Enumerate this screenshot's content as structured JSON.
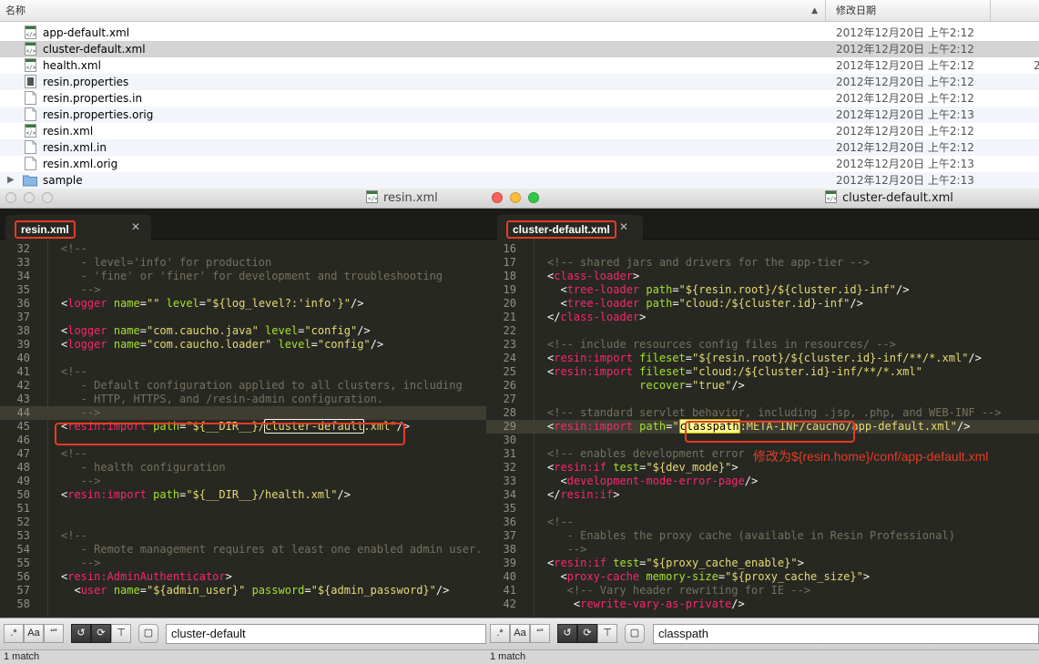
{
  "finder": {
    "col_name": "名称",
    "col_date": "修改日期",
    "rows": [
      {
        "name": "app-default.xml",
        "date": "2012年12月20日 上午2:12",
        "icon": "xml-file-icon"
      },
      {
        "name": "cluster-default.xml",
        "date": "2012年12月20日 上午2:12",
        "icon": "xml-file-icon"
      },
      {
        "name": "health.xml",
        "date": "2012年12月20日 上午2:12",
        "icon": "xml-file-icon",
        "extra": "2"
      },
      {
        "name": "resin.properties",
        "date": "2012年12月20日 上午2:12",
        "icon": "properties-file-icon"
      },
      {
        "name": "resin.properties.in",
        "date": "2012年12月20日 上午2:12",
        "icon": "document-icon"
      },
      {
        "name": "resin.properties.orig",
        "date": "2012年12月20日 上午2:13",
        "icon": "document-icon"
      },
      {
        "name": "resin.xml",
        "date": "2012年12月20日 上午2:12",
        "icon": "xml-file-icon"
      },
      {
        "name": "resin.xml.in",
        "date": "2012年12月20日 上午2:12",
        "icon": "document-icon"
      },
      {
        "name": "resin.xml.orig",
        "date": "2012年12月20日 上午2:13",
        "icon": "document-icon"
      },
      {
        "name": "sample",
        "date": "2012年12月20日 上午2:13",
        "icon": "folder-icon"
      }
    ]
  },
  "left_window": {
    "title": "resin.xml",
    "tab": "resin.xml",
    "find_text": "cluster-default",
    "status": "1 match",
    "lines": [
      {
        "n": "32",
        "segs": [
          [
            "com",
            "<!--"
          ]
        ]
      },
      {
        "n": "33",
        "segs": [
          [
            "com",
            "   - level='info' for production"
          ]
        ]
      },
      {
        "n": "34",
        "segs": [
          [
            "com",
            "   - 'fine' or 'finer' for development and troubleshooting"
          ]
        ]
      },
      {
        "n": "35",
        "segs": [
          [
            "com",
            "   -->"
          ]
        ]
      },
      {
        "n": "36",
        "segs": [
          [
            "p",
            "<"
          ],
          [
            "tag",
            "logger"
          ],
          [
            "p",
            " "
          ],
          [
            "att",
            "name"
          ],
          [
            "p",
            "="
          ],
          [
            "str",
            "\"\""
          ],
          [
            "p",
            " "
          ],
          [
            "att",
            "level"
          ],
          [
            "p",
            "="
          ],
          [
            "str",
            "\"${log_level?:'info'}\""
          ],
          [
            "p",
            "/>"
          ]
        ]
      },
      {
        "n": "37",
        "segs": []
      },
      {
        "n": "38",
        "segs": [
          [
            "p",
            "<"
          ],
          [
            "tag",
            "logger"
          ],
          [
            "p",
            " "
          ],
          [
            "att",
            "name"
          ],
          [
            "p",
            "="
          ],
          [
            "str",
            "\"com.caucho.java\""
          ],
          [
            "p",
            " "
          ],
          [
            "att",
            "level"
          ],
          [
            "p",
            "="
          ],
          [
            "str",
            "\"config\""
          ],
          [
            "p",
            "/>"
          ]
        ]
      },
      {
        "n": "39",
        "segs": [
          [
            "p",
            "<"
          ],
          [
            "tag",
            "logger"
          ],
          [
            "p",
            " "
          ],
          [
            "att",
            "name"
          ],
          [
            "p",
            "="
          ],
          [
            "str",
            "\"com.caucho.loader\""
          ],
          [
            "p",
            " "
          ],
          [
            "att",
            "level"
          ],
          [
            "p",
            "="
          ],
          [
            "str",
            "\"config\""
          ],
          [
            "p",
            "/>"
          ]
        ]
      },
      {
        "n": "40",
        "segs": []
      },
      {
        "n": "41",
        "segs": [
          [
            "com",
            "<!--"
          ]
        ]
      },
      {
        "n": "42",
        "segs": [
          [
            "com",
            "   - Default configuration applied to all clusters, including"
          ]
        ]
      },
      {
        "n": "43",
        "segs": [
          [
            "com",
            "   - HTTP, HTTPS, and /resin-admin configuration."
          ]
        ]
      },
      {
        "n": "44",
        "segs": [
          [
            "com",
            "   -->"
          ]
        ],
        "hl": true
      },
      {
        "n": "45",
        "segs": [
          [
            "p",
            "<"
          ],
          [
            "tag",
            "resin:import"
          ],
          [
            "p",
            " "
          ],
          [
            "att",
            "path"
          ],
          [
            "p",
            "="
          ],
          [
            "str",
            "\"${__DIR__}/"
          ],
          [
            "strbox",
            "cluster-default"
          ],
          [
            "str",
            ".xml\""
          ],
          [
            "p",
            "/>"
          ]
        ]
      },
      {
        "n": "46",
        "segs": []
      },
      {
        "n": "47",
        "segs": [
          [
            "com",
            "<!--"
          ]
        ]
      },
      {
        "n": "48",
        "segs": [
          [
            "com",
            "   - health configuration"
          ]
        ]
      },
      {
        "n": "49",
        "segs": [
          [
            "com",
            "   -->"
          ]
        ]
      },
      {
        "n": "50",
        "segs": [
          [
            "p",
            "<"
          ],
          [
            "tag",
            "resin:import"
          ],
          [
            "p",
            " "
          ],
          [
            "att",
            "path"
          ],
          [
            "p",
            "="
          ],
          [
            "str",
            "\"${__DIR__}/health.xml\""
          ],
          [
            "p",
            "/>"
          ]
        ]
      },
      {
        "n": "51",
        "segs": []
      },
      {
        "n": "52",
        "segs": []
      },
      {
        "n": "53",
        "segs": [
          [
            "com",
            "<!--"
          ]
        ]
      },
      {
        "n": "54",
        "segs": [
          [
            "com",
            "   - Remote management requires at least one enabled admin user."
          ]
        ]
      },
      {
        "n": "55",
        "segs": [
          [
            "com",
            "   -->"
          ]
        ]
      },
      {
        "n": "56",
        "segs": [
          [
            "p",
            "<"
          ],
          [
            "tag",
            "resin:AdminAuthenticator"
          ],
          [
            "p",
            ">"
          ]
        ]
      },
      {
        "n": "57",
        "segs": [
          [
            "p",
            "  <"
          ],
          [
            "tag",
            "user"
          ],
          [
            "p",
            " "
          ],
          [
            "att",
            "name"
          ],
          [
            "p",
            "="
          ],
          [
            "str",
            "\"${admin_user}\""
          ],
          [
            "p",
            " "
          ],
          [
            "att",
            "password"
          ],
          [
            "p",
            "="
          ],
          [
            "str",
            "\"${admin_password}\""
          ],
          [
            "p",
            "/>"
          ]
        ]
      },
      {
        "n": "58",
        "segs": []
      }
    ]
  },
  "right_window": {
    "title": "cluster-default.xml",
    "tab": "cluster-default.xml",
    "find_text": "classpath",
    "status": "1 match",
    "annotation": "修改为${resin.home}/conf/app-default.xml",
    "lines": [
      {
        "n": "16",
        "segs": []
      },
      {
        "n": "17",
        "segs": [
          [
            "com",
            "<!-- shared jars and drivers for the app-tier -->"
          ]
        ]
      },
      {
        "n": "18",
        "segs": [
          [
            "p",
            "<"
          ],
          [
            "tag",
            "class-loader"
          ],
          [
            "p",
            ">"
          ]
        ]
      },
      {
        "n": "19",
        "segs": [
          [
            "p",
            "  <"
          ],
          [
            "tag",
            "tree-loader"
          ],
          [
            "p",
            " "
          ],
          [
            "att",
            "path"
          ],
          [
            "p",
            "="
          ],
          [
            "str",
            "\"${resin.root}/${cluster.id}-inf\""
          ],
          [
            "p",
            "/>"
          ]
        ]
      },
      {
        "n": "20",
        "segs": [
          [
            "p",
            "  <"
          ],
          [
            "tag",
            "tree-loader"
          ],
          [
            "p",
            " "
          ],
          [
            "att",
            "path"
          ],
          [
            "p",
            "="
          ],
          [
            "str",
            "\"cloud:/${cluster.id}-inf\""
          ],
          [
            "p",
            "/>"
          ]
        ]
      },
      {
        "n": "21",
        "segs": [
          [
            "p",
            "</"
          ],
          [
            "tag",
            "class-loader"
          ],
          [
            "p",
            ">"
          ]
        ]
      },
      {
        "n": "22",
        "segs": []
      },
      {
        "n": "23",
        "segs": [
          [
            "com",
            "<!-- include resources config files in resources/ -->"
          ]
        ]
      },
      {
        "n": "24",
        "segs": [
          [
            "p",
            "<"
          ],
          [
            "tag",
            "resin:import"
          ],
          [
            "p",
            " "
          ],
          [
            "att",
            "fileset"
          ],
          [
            "p",
            "="
          ],
          [
            "str",
            "\"${resin.root}/${cluster.id}-inf/**/*.xml\""
          ],
          [
            "p",
            "/>"
          ]
        ]
      },
      {
        "n": "25",
        "segs": [
          [
            "p",
            "<"
          ],
          [
            "tag",
            "resin:import"
          ],
          [
            "p",
            " "
          ],
          [
            "att",
            "fileset"
          ],
          [
            "p",
            "="
          ],
          [
            "str",
            "\"cloud:/${cluster.id}-inf/**/*.xml\""
          ]
        ]
      },
      {
        "n": "26",
        "segs": [
          [
            "p",
            "              "
          ],
          [
            "att",
            "recover"
          ],
          [
            "p",
            "="
          ],
          [
            "str",
            "\"true\""
          ],
          [
            "p",
            "/>"
          ]
        ]
      },
      {
        "n": "27",
        "segs": []
      },
      {
        "n": "28",
        "segs": [
          [
            "com",
            "<!-- standard servlet behavior, including .jsp, .php, and WEB-INF -->"
          ]
        ]
      },
      {
        "n": "29",
        "segs": [
          [
            "p",
            "<"
          ],
          [
            "tag",
            "resin:import"
          ],
          [
            "p",
            " "
          ],
          [
            "att",
            "path"
          ],
          [
            "p",
            "="
          ],
          [
            "str",
            "\""
          ],
          [
            "hit",
            "classpath"
          ],
          [
            "str",
            ":META-INF/caucho/app-default.xml\""
          ],
          [
            "p",
            "/>"
          ]
        ],
        "hl": true
      },
      {
        "n": "30",
        "segs": []
      },
      {
        "n": "31",
        "segs": [
          [
            "com",
            "<!-- enables development error pages -->"
          ]
        ]
      },
      {
        "n": "32",
        "segs": [
          [
            "p",
            "<"
          ],
          [
            "tag",
            "resin:if"
          ],
          [
            "p",
            " "
          ],
          [
            "att",
            "test"
          ],
          [
            "p",
            "="
          ],
          [
            "str",
            "\"${dev_mode}\""
          ],
          [
            "p",
            ">"
          ]
        ]
      },
      {
        "n": "33",
        "segs": [
          [
            "p",
            "  <"
          ],
          [
            "tag",
            "development-mode-error-page"
          ],
          [
            "p",
            "/>"
          ]
        ]
      },
      {
        "n": "34",
        "segs": [
          [
            "p",
            "</"
          ],
          [
            "tag",
            "resin:if"
          ],
          [
            "p",
            ">"
          ]
        ]
      },
      {
        "n": "35",
        "segs": []
      },
      {
        "n": "36",
        "segs": [
          [
            "com",
            "<!--"
          ]
        ]
      },
      {
        "n": "37",
        "segs": [
          [
            "com",
            "   - Enables the proxy cache (available in Resin Professional)"
          ]
        ]
      },
      {
        "n": "38",
        "segs": [
          [
            "com",
            "   -->"
          ]
        ]
      },
      {
        "n": "39",
        "segs": [
          [
            "p",
            "<"
          ],
          [
            "tag",
            "resin:if"
          ],
          [
            "p",
            " "
          ],
          [
            "att",
            "test"
          ],
          [
            "p",
            "="
          ],
          [
            "str",
            "\"${proxy_cache_enable}\""
          ],
          [
            "p",
            ">"
          ]
        ]
      },
      {
        "n": "40",
        "segs": [
          [
            "p",
            "  <"
          ],
          [
            "tag",
            "proxy-cache"
          ],
          [
            "p",
            " "
          ],
          [
            "att",
            "memory-size"
          ],
          [
            "p",
            "="
          ],
          [
            "str",
            "\"${proxy_cache_size}\""
          ],
          [
            "p",
            ">"
          ]
        ]
      },
      {
        "n": "41",
        "segs": [
          [
            "com",
            "   <!-- Vary header rewriting for IE -->"
          ]
        ]
      },
      {
        "n": "42",
        "segs": [
          [
            "p",
            "    <"
          ],
          [
            "tag",
            "rewrite-vary-as-private"
          ],
          [
            "p",
            "/>"
          ]
        ]
      }
    ]
  },
  "findbar_buttons": {
    "regex": ".*",
    "case": "Aa",
    "word": "“”"
  }
}
